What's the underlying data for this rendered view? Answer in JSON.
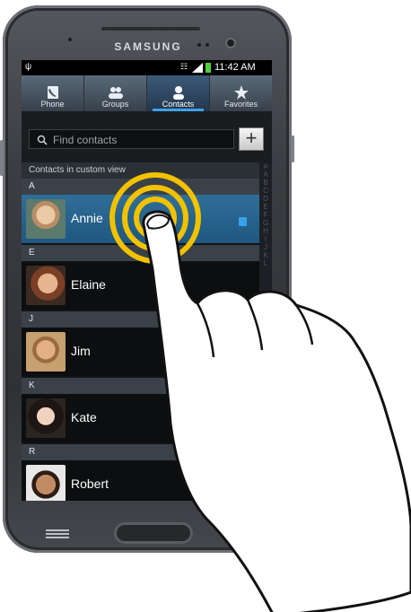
{
  "device": {
    "brand": "SAMSUNG"
  },
  "status_bar": {
    "time": "11:42 AM"
  },
  "tabs": [
    {
      "label": "Phone",
      "icon": "phone-icon"
    },
    {
      "label": "Groups",
      "icon": "groups-icon"
    },
    {
      "label": "Contacts",
      "icon": "contacts-icon",
      "active": true
    },
    {
      "label": "Favorites",
      "icon": "star-icon"
    }
  ],
  "search": {
    "placeholder": "Find contacts",
    "add_label": "+"
  },
  "list_header": "Contacts in custom view",
  "sections": [
    {
      "letter": "A",
      "contacts": [
        {
          "name": "Annie",
          "selected": true
        }
      ]
    },
    {
      "letter": "E",
      "contacts": [
        {
          "name": "Elaine"
        }
      ]
    },
    {
      "letter": "J",
      "contacts": [
        {
          "name": "Jim"
        }
      ]
    },
    {
      "letter": "K",
      "contacts": [
        {
          "name": "Kate"
        }
      ]
    },
    {
      "letter": "R",
      "contacts": [
        {
          "name": "Robert"
        }
      ]
    }
  ],
  "index_letters": [
    "#",
    "A",
    "B",
    "C",
    "D",
    "E",
    "F",
    "G",
    "H",
    "I",
    "J",
    "K",
    "L"
  ],
  "colors": {
    "accent": "#3fa0e6",
    "selected_row": "#1f5880",
    "tap_ring": "#f2c200"
  }
}
